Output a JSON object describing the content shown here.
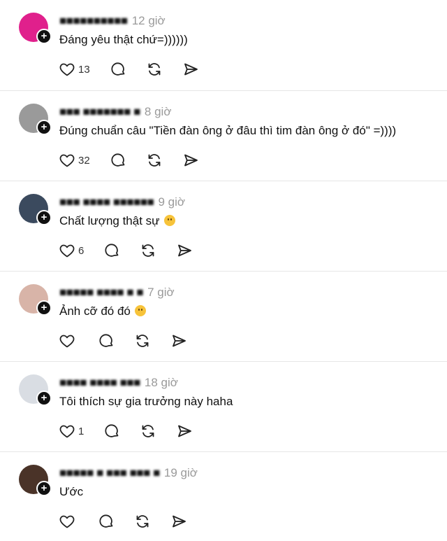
{
  "icons": {
    "like": "heart-icon",
    "reply": "speech-bubble-icon",
    "repost": "repost-icon",
    "share": "send-icon",
    "follow": "plus-icon"
  },
  "colors": {
    "text": "#111111",
    "muted": "#9a9a9a",
    "divider": "#e6e6e6"
  },
  "comments": [
    {
      "username": "■■■■■■■■■■",
      "time": "12 giờ",
      "text": "Đáng yêu thật chứ=))))))",
      "likes": "13",
      "avatar_color": "#e0208c"
    },
    {
      "username": "■■■ ■■■■■■■ ■",
      "time": "8 giờ",
      "text": "Đúng chuẩn câu \"Tiền đàn ông ở đâu thì tim đàn ông ở đó\" =))))",
      "likes": "32",
      "avatar_color": "#9a9a9a"
    },
    {
      "username": "■■■ ■■■■ ■■■■■■",
      "time": "9 giờ",
      "text": "Chất lượng thật sự",
      "emoji": "grin",
      "likes": "6",
      "avatar_color": "#3b4a5e"
    },
    {
      "username": "■■■■■ ■■■■ ■ ■",
      "time": "7 giờ",
      "text": "Ảnh cỡ đó đó",
      "emoji": "wow",
      "likes": "",
      "avatar_color": "#d8b4a8"
    },
    {
      "username": "■■■■ ■■■■ ■■■",
      "time": "18 giờ",
      "text": "Tôi thích sự gia trưởng này haha",
      "likes": "1",
      "avatar_color": "#d9dde3"
    },
    {
      "username": "■■■■■ ■ ■■■ ■■■ ■",
      "time": "19 giờ",
      "text": "Ước",
      "likes": "",
      "avatar_color": "#4a3328"
    }
  ]
}
